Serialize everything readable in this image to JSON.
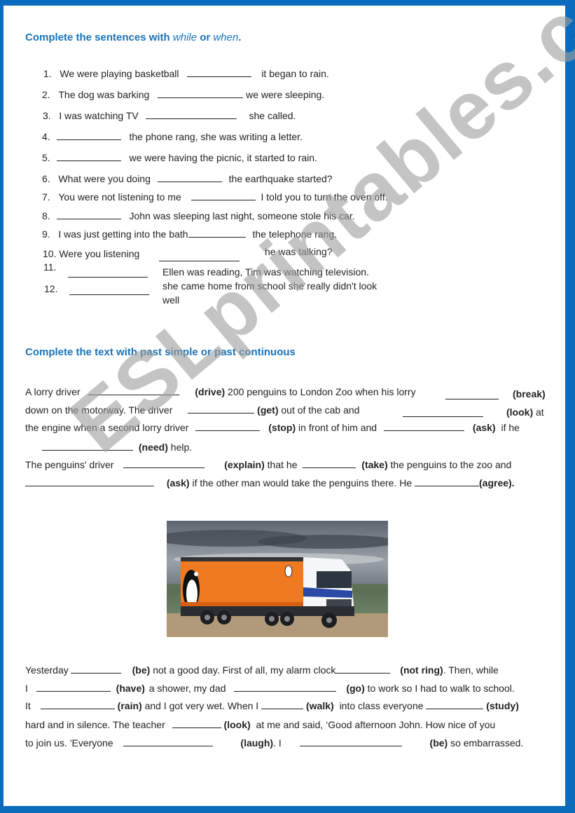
{
  "section1": {
    "heading_prefix": "Complete the sentences with",
    "heading_while": "while",
    "heading_or": "or",
    "heading_when": "when",
    "heading_suffix": ".",
    "items": [
      {
        "num": "1.",
        "before": "We were playing basketball",
        "after": "it began to rain."
      },
      {
        "num": "2.",
        "before": "The dog was barking",
        "after": "we were sleeping."
      },
      {
        "num": "3.",
        "before": "I was watching TV",
        "after": "she called."
      },
      {
        "num": "4.",
        "before": "",
        "after": "the phone rang, she was writing a letter."
      },
      {
        "num": "5.",
        "before": "",
        "after": "we were having the picnic, it started to rain."
      },
      {
        "num": "6.",
        "before": "What were you doing",
        "after": "the earthquake started?"
      },
      {
        "num": "7.",
        "before": "You were not listening to me",
        "after": "I told you to turn the oven off."
      },
      {
        "num": "8.",
        "before": "",
        "after": "John was sleeping last night, someone stole his car."
      },
      {
        "num": "9.",
        "before": "I was just getting into the bath",
        "after": "the telephone rang."
      },
      {
        "num": "10.",
        "before": "Were you listening",
        "after": "he was talking?"
      },
      {
        "num": "11.",
        "before": "",
        "after": "Ellen was reading, Tim was watching television."
      },
      {
        "num": "12.",
        "before": "",
        "after": "she came home from school she really didn't look",
        "after2": "well"
      }
    ]
  },
  "section2": {
    "heading": "Complete the text with past simple or past continuous",
    "l1": {
      "a": "A lorry driver",
      "v1": "(drive)",
      "b": "200 penguins to London Zoo when his lorry",
      "v2": "(break)"
    },
    "l2": {
      "a": "down on the motorway. The driver",
      "v1": "(get)",
      "b": "out of the cab and",
      "v2": "(look)",
      "c": "at"
    },
    "l3": {
      "a": "the engine when a second lorry driver",
      "v1": "(stop)",
      "b": "in front of him and",
      "v2": "(ask)",
      "c": "if he"
    },
    "l4": {
      "v1": "(need)",
      "b": "help."
    },
    "l5": {
      "a": "The penguins' driver",
      "v1": "(explain)",
      "b": "that he",
      "v2": "(take)",
      "c": "the penguins to the zoo and"
    },
    "l6": {
      "v1": "(ask)",
      "b": "if the other man would take the penguins there. He",
      "v2": "(agree)."
    },
    "image_alt": "Orange Penguin Books lorry with penguin logo under a cloudy sky"
  },
  "section3": {
    "l1": {
      "a": "Yesterday",
      "v1": "(be)",
      "b": "not a good day. First of all, my alarm clock",
      "v2": "(not ring)",
      "c": ". Then, while"
    },
    "l2": {
      "a": "I",
      "v1": "(have)",
      "b": "a shower, my dad",
      "v2": "(go)",
      "c": "to work so I had to walk to school."
    },
    "l3": {
      "a": "It",
      "v1": "(rain)",
      "b": "and I got very wet. When I",
      "v2": "(walk)",
      "c": "into class everyone",
      "v3": "(study)"
    },
    "l4": {
      "a": "hard and in silence. The teacher",
      "v1": "(look)",
      "b": "at me and said, ‘Good afternoon John. How nice of you"
    },
    "l5": {
      "a": "to join us. 'Everyone",
      "v1": "(laugh)",
      "b": ". I",
      "v2": "(be)",
      "c": "so embarrassed."
    }
  },
  "watermark": "ESLprintables.com",
  "colors": {
    "border": "#0b6cbd",
    "heading": "#1a73b8"
  }
}
